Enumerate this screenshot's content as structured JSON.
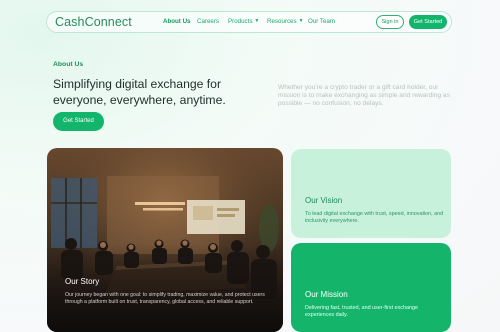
{
  "nav": {
    "logo": "CashConnect",
    "links": [
      {
        "label": "About Us",
        "active": true
      },
      {
        "label": "Careers",
        "active": false
      },
      {
        "label": "Products",
        "active": false,
        "dropdown": true
      },
      {
        "label": "Resources",
        "active": false,
        "dropdown": true
      },
      {
        "label": "Our Team",
        "active": false
      }
    ],
    "signin_label": "Sign in",
    "cta_label": "Get Started"
  },
  "hero": {
    "eyebrow": "About Us",
    "headline": "Simplifying digital exchange for everyone, everywhere, anytime.",
    "cta_label": "Get Started",
    "statement": "Whether you're a crypto trader or a gift card holder, our mission is to make exchanging as simple and rewarding as possible — no confusion, no delays."
  },
  "cards": {
    "story": {
      "title": "Our Story",
      "text": "Our journey began with one goal: to simplify trading, maximize value, and protect users through a platform built on trust, transparency, global access, and reliable support."
    },
    "vision": {
      "title": "Our Vision",
      "text": "To lead digital exchange with trust, speed, innovation, and inclusivity everywhere."
    },
    "mission": {
      "title": "Our Mission",
      "text": "Delivering fast, trusted, and user-first exchange experiences daily."
    }
  },
  "colors": {
    "accent": "#13b46b",
    "accent_dark": "#17995e",
    "vision_bg": "#c8f1dc"
  }
}
